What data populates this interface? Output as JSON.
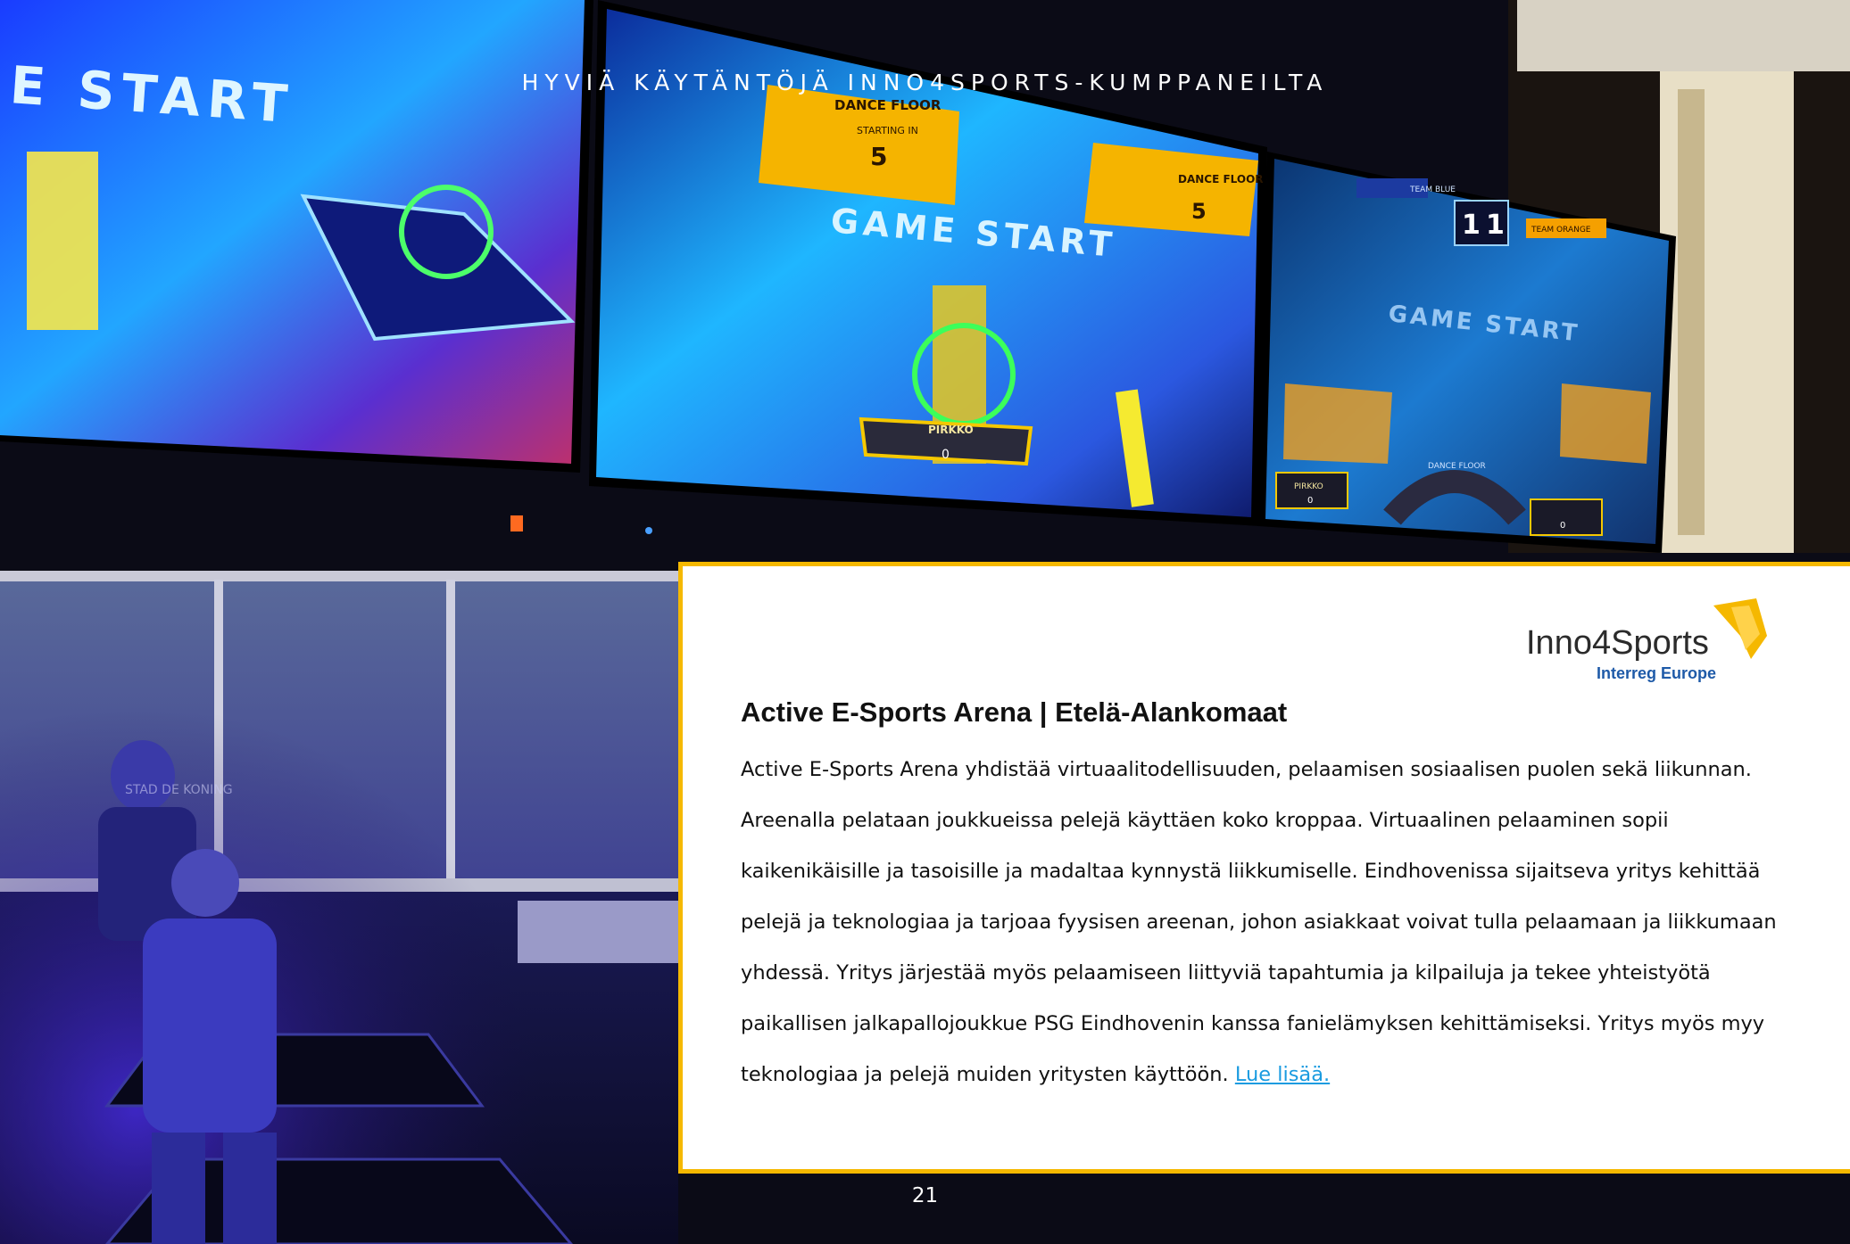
{
  "header": {
    "text": "HYVIÄ KÄYTÄNTÖJÄ INNO4SPORTS-KUMPPANEILTA"
  },
  "photo_screens": {
    "left_text": "E START",
    "center_panel_title": "DANCE FLOOR",
    "center_panel_sub": "STARTING IN",
    "center_panel_count": "5",
    "center_game_start": "GAME START",
    "right_panel_title": "DANCE FLOOR",
    "right_panel_count": "5",
    "player_name": "PIRKKO",
    "player_score": "0",
    "scoreboard_left": "1",
    "scoreboard_right": "1",
    "team_left": "TEAM BLUE",
    "team_right": "TEAM ORANGE",
    "right_game_start": "GAME START",
    "right_floor_label": "DANCE FLOOR",
    "right_player_name": "PIRKKO",
    "right_player_score": "0",
    "right_player_score_2": "0",
    "window_sign": "STAD DE KONING"
  },
  "logo": {
    "name": "Inno4Sports",
    "sub": "Interreg Europe",
    "brand_color": "#f5b800",
    "name_color": "#2b2b2b",
    "sub_color": "#1e5aa8"
  },
  "card": {
    "title": "Active E-Sports Arena | Etelä-Alankomaat",
    "lines": [
      "Active E-Sports Arena yhdistää virtuaalitodellisuuden, pelaamisen sosiaalisen puolen sekä liikunnan.",
      "Areenalla pelataan joukkueissa pelejä käyttäen koko kroppaa. Virtuaalinen pelaaminen sopii",
      "kaikenikäisille ja tasoisille ja madaltaa kynnystä liikkumiselle. Eindhovenissa sijaitseva yritys kehittää",
      "pelejä ja teknologiaa ja tarjoaa fyysisen areenan, johon asiakkaat voivat tulla pelaamaan ja liikkumaan",
      "yhdessä. Yritys järjestää myös pelaamiseen liittyviä tapahtumia ja kilpailuja ja tekee yhteistyötä",
      "paikallisen jalkapallojoukkue PSG Eindhovenin kanssa fanielämyksen kehittämiseksi. Yritys myös myy"
    ],
    "last_line_text": "teknologiaa ja pelejä muiden yritysten käyttöön. ",
    "link_text": "Lue lisää.",
    "border_color": "#f5b800",
    "link_color": "#1a9be0"
  },
  "page": {
    "number": "21"
  }
}
